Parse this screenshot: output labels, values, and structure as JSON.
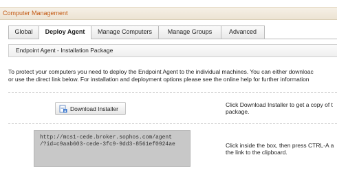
{
  "panel": {
    "title": "Computer Management"
  },
  "tabs": [
    {
      "label": "Global"
    },
    {
      "label": "Deploy Agent",
      "active": true
    },
    {
      "label": "Manage Computers"
    },
    {
      "label": "Manage Groups"
    },
    {
      "label": "Advanced"
    }
  ],
  "subheader": "Endpoint Agent - Installation Package",
  "intro": {
    "line1": "To protect your computers you need to deploy the Endpoint Agent to the individual machines. You can either downloac",
    "line2": "or use the direct link below. For installation and deployment options please see the online help for further information"
  },
  "download": {
    "button_label": "Download Installer",
    "icon": "download-installer-icon",
    "help_line1": "Click Download Installer to get a copy of t",
    "help_line2": "package."
  },
  "link": {
    "line1": "http://mcs1-cede.broker.sophos.com/agent",
    "line2": "/?id=c9aab603-cede-3fc9-9dd3-8561ef0924ae",
    "help_line1": "Click inside the box, then press CTRL-A a",
    "help_line2": "the link to the clipboard."
  },
  "colors": {
    "title_text": "#c35a14",
    "title_bar": "#f3ecdf",
    "link_box": "#c8c8c8"
  }
}
